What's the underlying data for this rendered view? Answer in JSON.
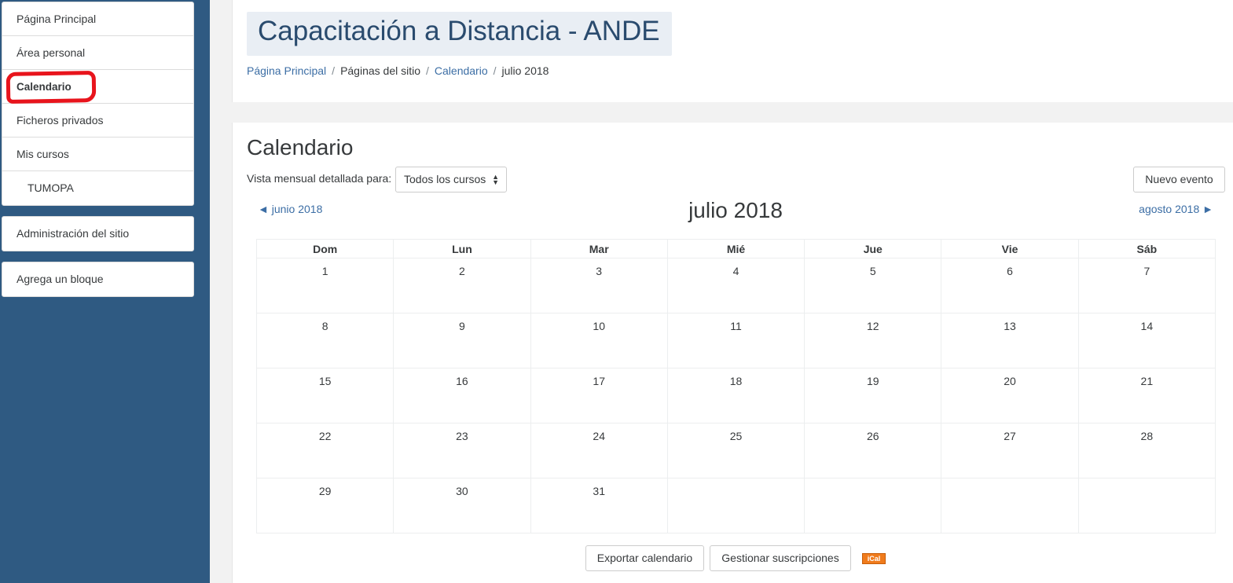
{
  "sidebar": {
    "nav": [
      {
        "label": "Página Principal"
      },
      {
        "label": "Área personal"
      },
      {
        "label": "Calendario"
      },
      {
        "label": "Ficheros privados"
      },
      {
        "label": "Mis cursos"
      },
      {
        "label": "TUMOPA"
      }
    ],
    "admin_label": "Administración del sitio",
    "add_block_label": "Agrega un bloque"
  },
  "header": {
    "title": "Capacitación a Distancia - ANDE",
    "breadcrumb": [
      "Página Principal",
      "Páginas del sitio",
      "Calendario",
      "julio 2018"
    ],
    "separator": "/"
  },
  "main": {
    "title": "Calendario",
    "vista_label": "Vista mensual detallada para:",
    "course_select": "Todos los cursos",
    "new_event_label": "Nuevo evento",
    "prev_month": "◄ junio 2018",
    "next_month": "agosto 2018 ►",
    "month_title": "julio 2018",
    "weekdays": [
      "Dom",
      "Lun",
      "Mar",
      "Mié",
      "Jue",
      "Vie",
      "Sáb"
    ],
    "weeks": [
      [
        "1",
        "2",
        "3",
        "4",
        "5",
        "6",
        "7"
      ],
      [
        "8",
        "9",
        "10",
        "11",
        "12",
        "13",
        "14"
      ],
      [
        "15",
        "16",
        "17",
        "18",
        "19",
        "20",
        "21"
      ],
      [
        "22",
        "23",
        "24",
        "25",
        "26",
        "27",
        "28"
      ],
      [
        "29",
        "30",
        "31",
        "",
        "",
        "",
        ""
      ]
    ],
    "export_label": "Exportar calendario",
    "manage_label": "Gestionar suscripciones",
    "ical_label": "iCal"
  },
  "colors": {
    "sidebar_bg": "#2f5a82",
    "link": "#3c6ea5",
    "annotation": "#e8141c",
    "ical": "#f07b1c"
  }
}
